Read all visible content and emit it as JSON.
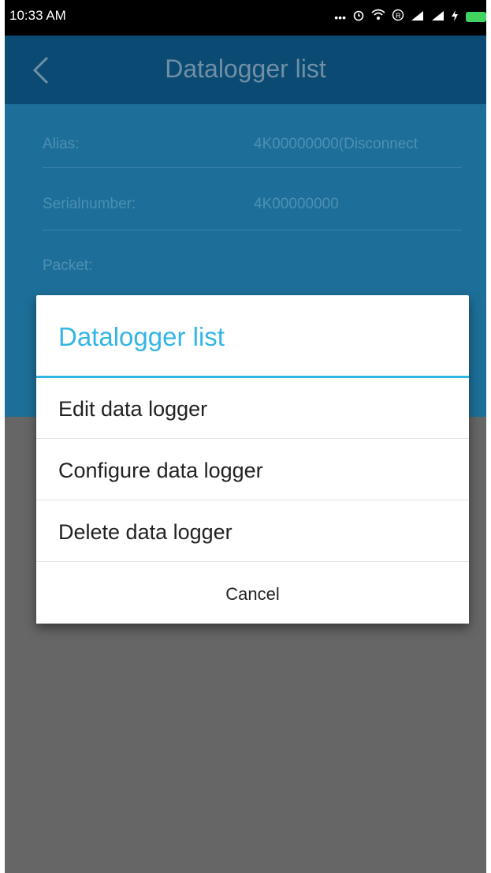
{
  "status_bar": {
    "time": "10:33 AM",
    "icons": [
      "more-dots-icon",
      "alarm-icon",
      "wifi-icon",
      "roaming-icon",
      "signal-icon",
      "signal-icon",
      "charging-icon",
      "battery-icon"
    ]
  },
  "app_bar": {
    "title": "Datalogger list",
    "back_icon": "chevron-left-icon"
  },
  "details": {
    "alias_label": "Alias:",
    "alias_value": "4K00000000(Disconnect",
    "serial_label": "Serialnumber:",
    "serial_value": "4K00000000",
    "packet_label": "Packet:"
  },
  "dialog": {
    "title": "Datalogger list",
    "items": [
      {
        "label": "Edit data logger"
      },
      {
        "label": "Configure data logger"
      },
      {
        "label": "Delete data logger"
      }
    ],
    "cancel_label": "Cancel"
  },
  "colors": {
    "app_bar": "#0b4a72",
    "content_dimmed": "#1d6f99",
    "dialog_accent": "#33b5e5",
    "overlay": "#666666",
    "battery": "#41d35f"
  }
}
